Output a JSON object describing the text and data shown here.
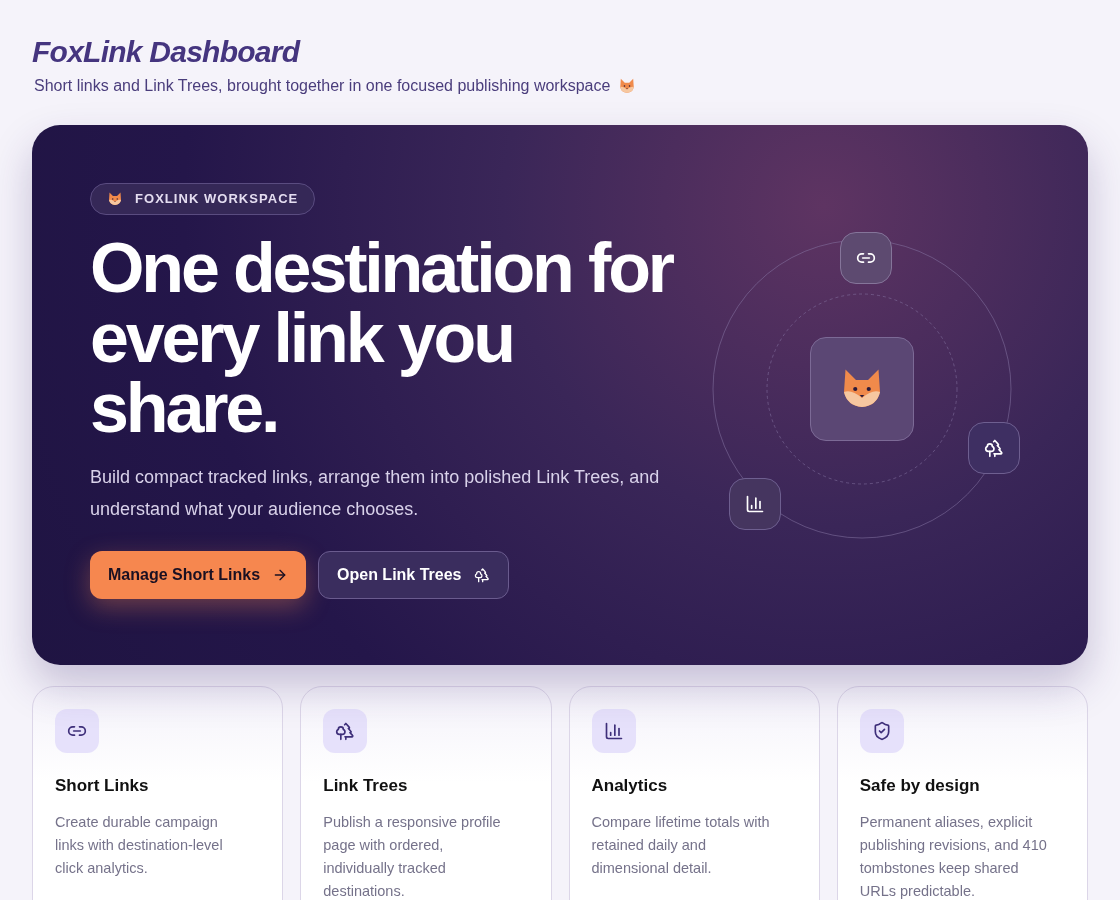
{
  "header": {
    "title": "FoxLink Dashboard",
    "subtitle": "Short links and Link Trees, brought together in one focused publishing workspace"
  },
  "hero": {
    "badge": "FOXLINK WORKSPACE",
    "headline": "One destination for every link you share.",
    "description": "Build compact tracked links, arrange them into polished Link Trees, and understand what your audience chooses.",
    "buttons": [
      {
        "label": "Manage Short Links",
        "kind": "primary"
      },
      {
        "label": "Open Link Trees",
        "kind": "secondary"
      }
    ]
  },
  "features": [
    {
      "kind": "link",
      "title": "Short Links",
      "description": "Create durable campaign links with destination-level click analytics."
    },
    {
      "kind": "tree",
      "title": "Link Trees",
      "description": "Publish a responsive profile page with ordered, individually tracked destinations."
    },
    {
      "kind": "chart",
      "title": "Analytics",
      "description": "Compare lifetime totals with retained daily and dimensional detail."
    },
    {
      "kind": "shield",
      "title": "Safe by design",
      "description": "Permanent aliases, explicit publishing revisions, and 410 tombstones keep shared URLs predictable."
    }
  ]
}
